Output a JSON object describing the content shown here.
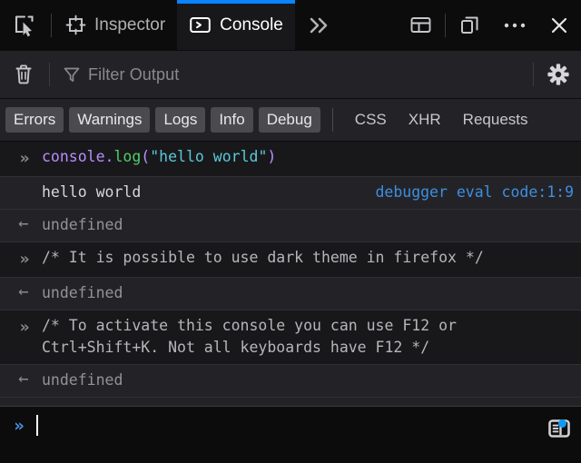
{
  "tabbar": {
    "picker_title": "Pick an element from the page",
    "picker_icon": "element-picker-icon",
    "tabs": [
      {
        "id": "inspector",
        "label": "Inspector",
        "icon": "inspector-target-icon",
        "active": false
      },
      {
        "id": "console",
        "label": "Console",
        "icon": "console-prompt-icon",
        "active": true
      }
    ],
    "overflow_label": "»",
    "overflow_icon": "chevron-double-right-icon",
    "dock_icon": "dock-layout-icon",
    "responsive_icon": "responsive-design-mode-icon",
    "meatball_label": "•••",
    "meatball_icon": "meatball-menu-icon",
    "close_label": "✕",
    "close_icon": "close-icon",
    "active_tab_accent": "#0a84ff"
  },
  "toolbar": {
    "clear_icon": "trash-icon",
    "clear_title": "Clear console output",
    "filter_icon": "funnel-icon",
    "filter_placeholder": "Filter Output",
    "filter_value": "",
    "settings_icon": "gear-icon",
    "settings_title": "Console settings"
  },
  "filters": {
    "chips": [
      {
        "id": "errors",
        "label": "Errors",
        "active": true
      },
      {
        "id": "warnings",
        "label": "Warnings",
        "active": true
      },
      {
        "id": "logs",
        "label": "Logs",
        "active": true
      },
      {
        "id": "info",
        "label": "Info",
        "active": true
      },
      {
        "id": "debug",
        "label": "Debug",
        "active": true
      }
    ],
    "plain": [
      {
        "id": "css",
        "label": "CSS"
      },
      {
        "id": "xhr",
        "label": "XHR"
      },
      {
        "id": "requests",
        "label": "Requests"
      }
    ]
  },
  "console_rows": [
    {
      "kind": "input",
      "gutter": "»",
      "gutter_icon": "chevron-double-right-icon",
      "tokens": [
        {
          "text": "console",
          "type": "object"
        },
        {
          "text": ".",
          "type": "punct"
        },
        {
          "text": "log",
          "type": "property"
        },
        {
          "text": "(",
          "type": "punct"
        },
        {
          "text": "\"hello world\"",
          "type": "string"
        },
        {
          "text": ")",
          "type": "punct"
        }
      ],
      "plain": "console.log(\"hello world\")"
    },
    {
      "kind": "output",
      "gutter": "",
      "message": "hello world",
      "source_link": "debugger eval code:1:9"
    },
    {
      "kind": "return",
      "gutter": "←",
      "gutter_icon": "arrow-left-icon",
      "message": "undefined"
    },
    {
      "kind": "input-comment",
      "gutter": "»",
      "gutter_icon": "chevron-double-right-icon",
      "message": "/* It is possible to use dark theme in firefox */"
    },
    {
      "kind": "return",
      "gutter": "←",
      "gutter_icon": "arrow-left-icon",
      "message": "undefined"
    },
    {
      "kind": "input-comment",
      "gutter": "»",
      "gutter_icon": "chevron-double-right-icon",
      "message": "/* To activate this console you can use F12 or Ctrl+Shift+K. Not all keyboards have F12 */"
    },
    {
      "kind": "return",
      "gutter": "←",
      "gutter_icon": "arrow-left-icon",
      "message": "undefined"
    }
  ],
  "jsterm": {
    "prompt": "»",
    "prompt_icon": "chevron-double-right-icon",
    "value": "",
    "placeholder": "",
    "editor_toggle_icon": "editor-mode-icon",
    "editor_toggle_title": "Switch to multi-line editor mode",
    "badge_color": "#0a9bf5",
    "prompt_color": "#4a90e2"
  },
  "theme": {
    "background": "#0c0c0d",
    "panel": "#232327",
    "input_row": "#18181b",
    "accent": "#0a84ff",
    "link": "#3d8fe0",
    "text": "#d7d7db"
  }
}
